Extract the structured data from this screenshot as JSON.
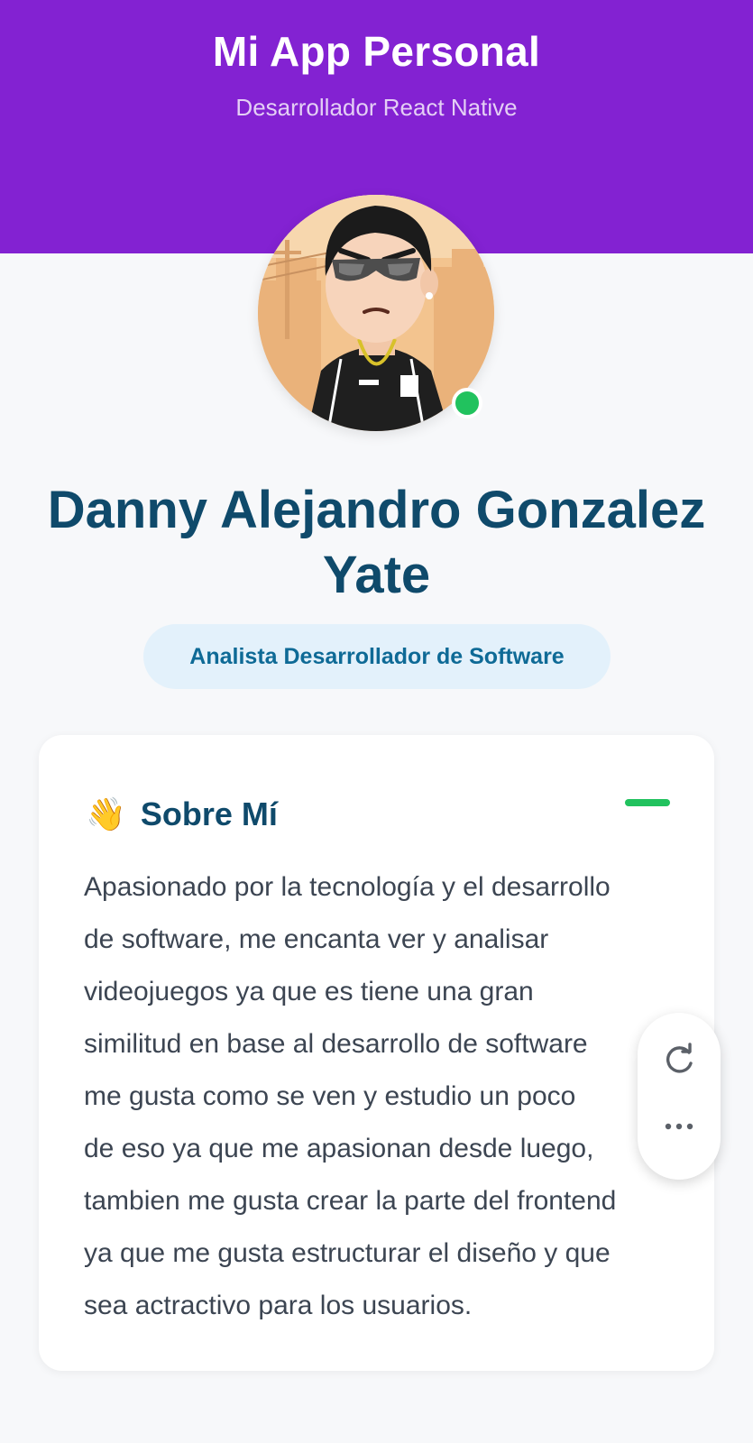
{
  "header": {
    "title": "Mi App Personal",
    "subtitle": "Desarrollador React Native"
  },
  "profile": {
    "name": "Danny Alejandro Gonzalez Yate",
    "role": "Analista Desarrollador de Software",
    "status": "online",
    "status_color": "#21c25e"
  },
  "about": {
    "icon": "waving-hand-icon",
    "emoji": "👋",
    "title": "Sobre Mí",
    "text": "Apasionado por la tecnología y el desarrollo\nde software, me encanta ver y analisar\nvideojuegos ya que es tiene una gran\nsimilitud en base al desarrollo de software\nme gusta como se ven y estudio un poco\nde eso ya que me apasionan desde luego,\ntambien me gusta crear la parte del frontend\nya que me gusta estructurar el diseño y que\nsea actractivo para los usuarios."
  },
  "floating_panel": {
    "refresh_icon": "refresh-icon",
    "more_icon": "more-horizontal-icon"
  },
  "colors": {
    "header": "#8322d2",
    "name": "#0f4a6b",
    "role_bg": "#e3f1fb",
    "role_text": "#0e6a96",
    "accent_green": "#21c25e"
  }
}
